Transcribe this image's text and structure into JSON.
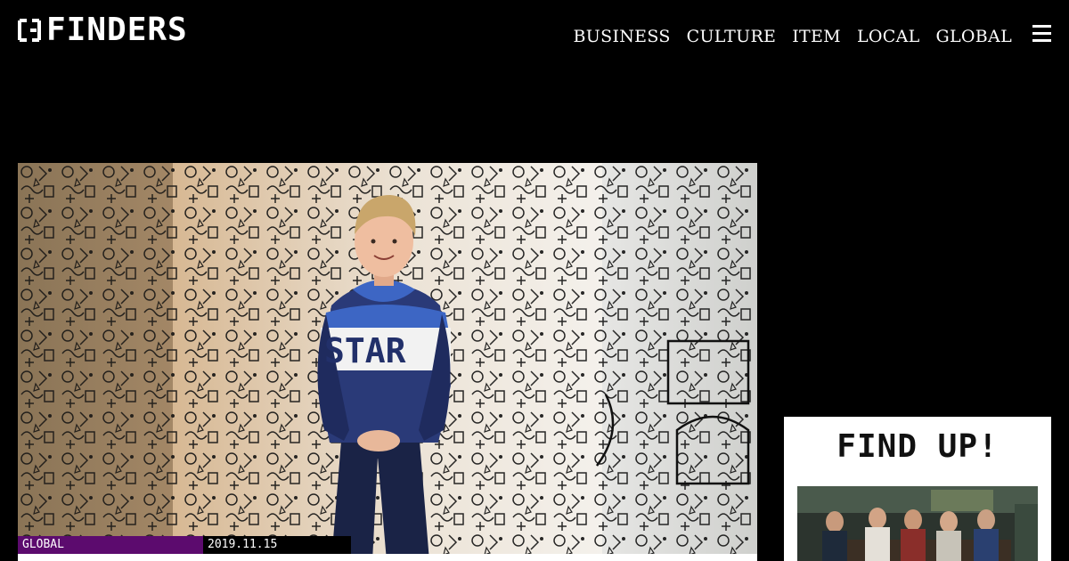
{
  "header": {
    "logo_text": "FINDERS",
    "nav": [
      {
        "label": "BUSINESS"
      },
      {
        "label": "CULTURE"
      },
      {
        "label": "ITEM"
      },
      {
        "label": "LOCAL"
      },
      {
        "label": "GLOBAL"
      }
    ],
    "menu_icon": "hamburger-menu-icon"
  },
  "hero": {
    "category": "GLOBAL",
    "date": "2019.11.15",
    "category_color": "#5c0b6e",
    "image": "boy-standing-in-front-of-doodle-covered-wall",
    "sweater_text": "STAR"
  },
  "sidebar": {
    "findup_title": "FIND UP!",
    "thumbnail": "group-of-people-in-dim-room-photo"
  },
  "colors": {
    "background": "#000000",
    "text": "#ffffff",
    "accent": "#5c0b6e"
  }
}
